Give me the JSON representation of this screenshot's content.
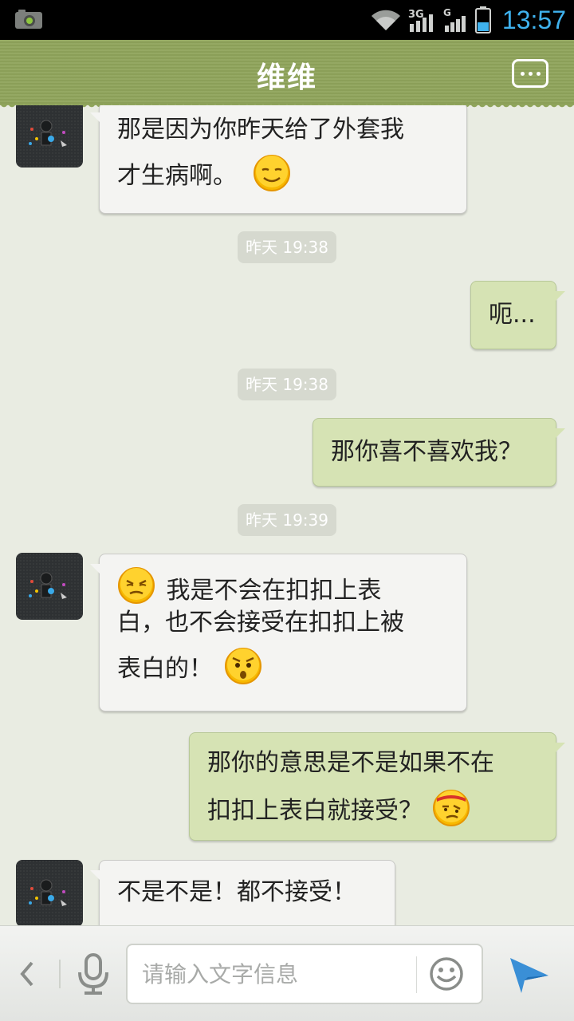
{
  "status_bar": {
    "time": "13:57",
    "icons": [
      "android-camera-icon",
      "wifi-icon",
      "3g-signal-icon",
      "g-signal-icon",
      "battery-icon"
    ],
    "network_3g": "3G",
    "network_g": "G"
  },
  "header": {
    "title": "维维",
    "menu_icon": "more-icon"
  },
  "messages": [
    {
      "side": "left",
      "text": "那是因为你昨天给了外套我才生病啊。",
      "emoji_after": "smile-emoji"
    },
    {
      "type": "timestamp",
      "text": "昨天 19:38"
    },
    {
      "side": "right",
      "text": "呃..."
    },
    {
      "type": "timestamp",
      "text": "昨天 19:38"
    },
    {
      "side": "right",
      "text": "那你喜不喜欢我？"
    },
    {
      "type": "timestamp",
      "text": "昨天 19:39"
    },
    {
      "side": "left",
      "text": "我是不会在扣扣上表白，也不会接受在扣扣上被表白的！",
      "emoji_before": "frown-emoji",
      "emoji_after": "surprised-emoji"
    },
    {
      "side": "right",
      "text": "那你的意思是不是如果不在扣扣上表白就接受？",
      "emoji_after": "suspicious-emoji"
    },
    {
      "side": "left",
      "text": "不是不是！都不接受！"
    }
  ],
  "texts": {
    "m1_line1": "那是因为你昨天给了外套我",
    "m1_line2": "才生病啊。",
    "ts1": "昨天 19:38",
    "m2": "呃...",
    "ts2": "昨天 19:38",
    "m3": "那你喜不喜欢我？",
    "ts3": "昨天 19:39",
    "m4_line1": "我是不会在扣扣上表",
    "m4_line2": "白，也不会接受在扣扣上被",
    "m4_line3": "表白的！",
    "m5_line1": "那你的意思是不是如果不在",
    "m5_line2": "扣扣上表白就接受？",
    "m6": "不是不是！都不接受！"
  },
  "input_bar": {
    "placeholder": "请输入文字信息",
    "icons": [
      "back-chevron-icon",
      "microphone-icon",
      "emoji-face-icon",
      "send-icon"
    ]
  },
  "colors": {
    "title_bar": "#8fa45b",
    "chat_bg": "#e9ece2",
    "bubble_self": "#d6e3b4",
    "bubble_other": "#f4f4f2",
    "status_time": "#3fb2ee",
    "send_icon": "#3a8fd6"
  }
}
